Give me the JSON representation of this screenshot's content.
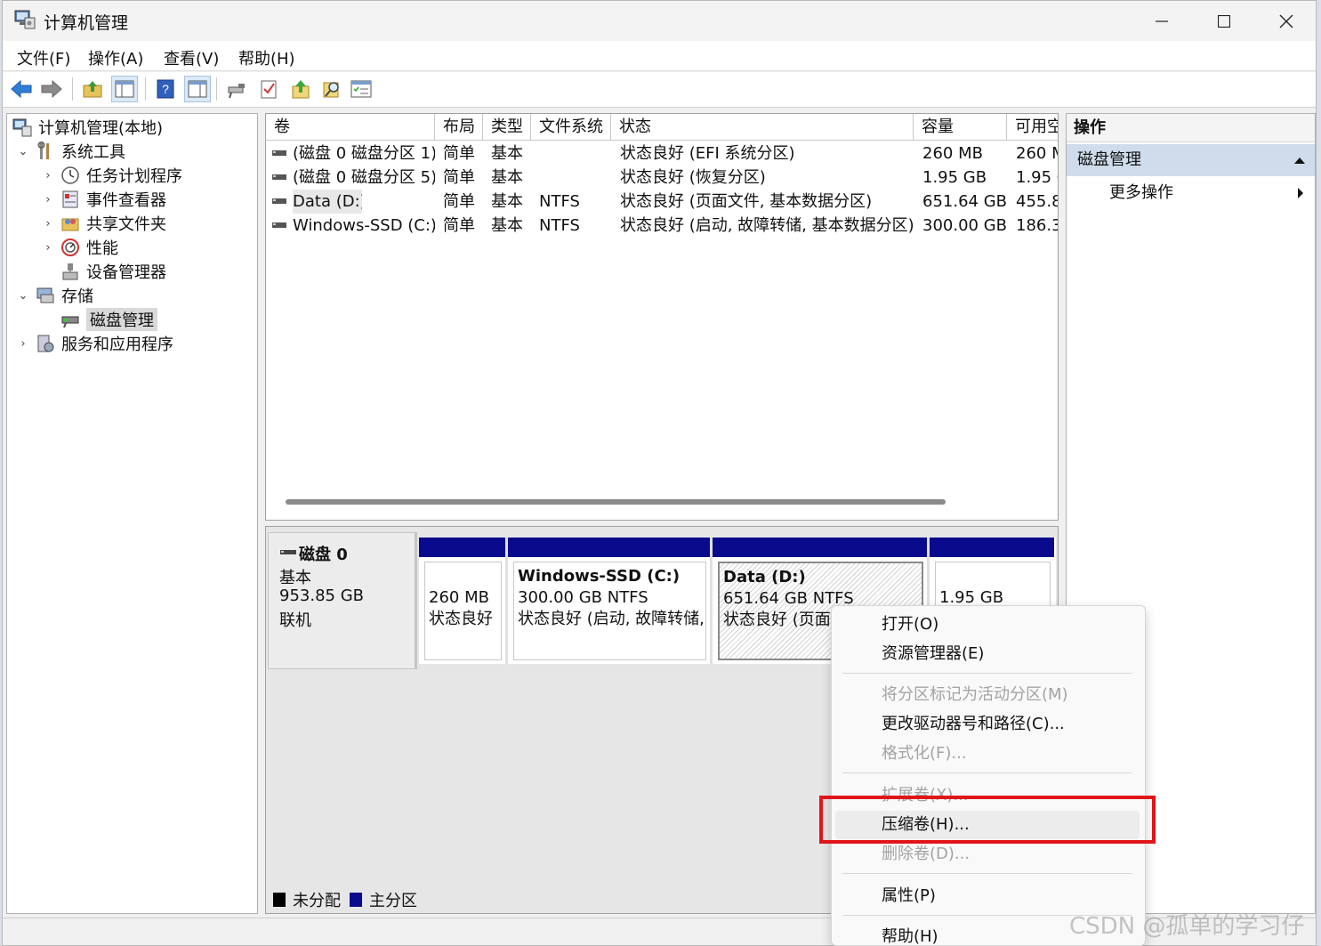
{
  "window": {
    "title": "计算机管理",
    "controls": {
      "minimize": "minimize-icon",
      "maximize": "maximize-icon",
      "close": "close-icon"
    }
  },
  "menu": [
    "文件(F)",
    "操作(A)",
    "查看(V)",
    "帮助(H)"
  ],
  "toolbar": {
    "icons": [
      "back-arrow-icon",
      "forward-arrow-icon",
      "up-folder-icon",
      "show-tree-icon",
      "help-icon",
      "show-action-pane-icon",
      "connect-icon",
      "checklist-icon",
      "export-icon",
      "search-icon",
      "properties-icon"
    ]
  },
  "tree": {
    "root": "计算机管理(本地)",
    "system_tools": "系统工具",
    "task_scheduler": "任务计划程序",
    "event_viewer": "事件查看器",
    "shared_folders": "共享文件夹",
    "performance": "性能",
    "device_manager": "设备管理器",
    "storage": "存储",
    "disk_management": "磁盘管理",
    "services_apps": "服务和应用程序"
  },
  "volumes": {
    "headers": [
      "卷",
      "布局",
      "类型",
      "文件系统",
      "状态",
      "容量",
      "可用空"
    ],
    "rows": [
      [
        "(磁盘 0 磁盘分区 1)",
        "简单",
        "基本",
        "",
        "状态良好 (EFI 系统分区)",
        "260 MB",
        "260 M"
      ],
      [
        "(磁盘 0 磁盘分区 5)",
        "简单",
        "基本",
        "",
        "状态良好 (恢复分区)",
        "1.95 GB",
        "1.95 G"
      ],
      [
        "Data (D:)",
        "简单",
        "基本",
        "NTFS",
        "状态良好 (页面文件, 基本数据分区)",
        "651.64 GB",
        "455.8"
      ],
      [
        "Windows-SSD (C:)",
        "简单",
        "基本",
        "NTFS",
        "状态良好 (启动, 故障转储, 基本数据分区)",
        "300.00 GB",
        "186.3"
      ]
    ]
  },
  "disk": {
    "name": "磁盘 0",
    "type": "基本",
    "size": "953.85 GB",
    "status": "联机",
    "partitions": [
      {
        "title": "",
        "line1": "260 MB",
        "line2": "状态良好"
      },
      {
        "title": "Windows-SSD  (C:)",
        "line1": "300.00 GB NTFS",
        "line2": "状态良好 (启动, 故障转储,"
      },
      {
        "title": "Data  (D:)",
        "line1": "651.64 GB NTFS",
        "line2": "状态良好 (页面文"
      },
      {
        "title": "",
        "line1": "1.95 GB",
        "line2": ""
      }
    ]
  },
  "legend": {
    "unallocated": "未分配",
    "primary": "主分区",
    "unallocated_color": "#000000",
    "primary_color": "#0a0a8c"
  },
  "actions": {
    "header": "操作",
    "section": "磁盘管理",
    "more": "更多操作"
  },
  "context_menu": {
    "open": "打开(O)",
    "explorer": "资源管理器(E)",
    "mark_active": "将分区标记为活动分区(M)",
    "change_letter": "更改驱动器号和路径(C)...",
    "format": "格式化(F)...",
    "extend": "扩展卷(X)...",
    "shrink": "压缩卷(H)...",
    "delete": "删除卷(D)...",
    "properties": "属性(P)",
    "help": "帮助(H)"
  },
  "highlight_color": "#e0151a",
  "watermark": "CSDN @孤单的学习仔"
}
